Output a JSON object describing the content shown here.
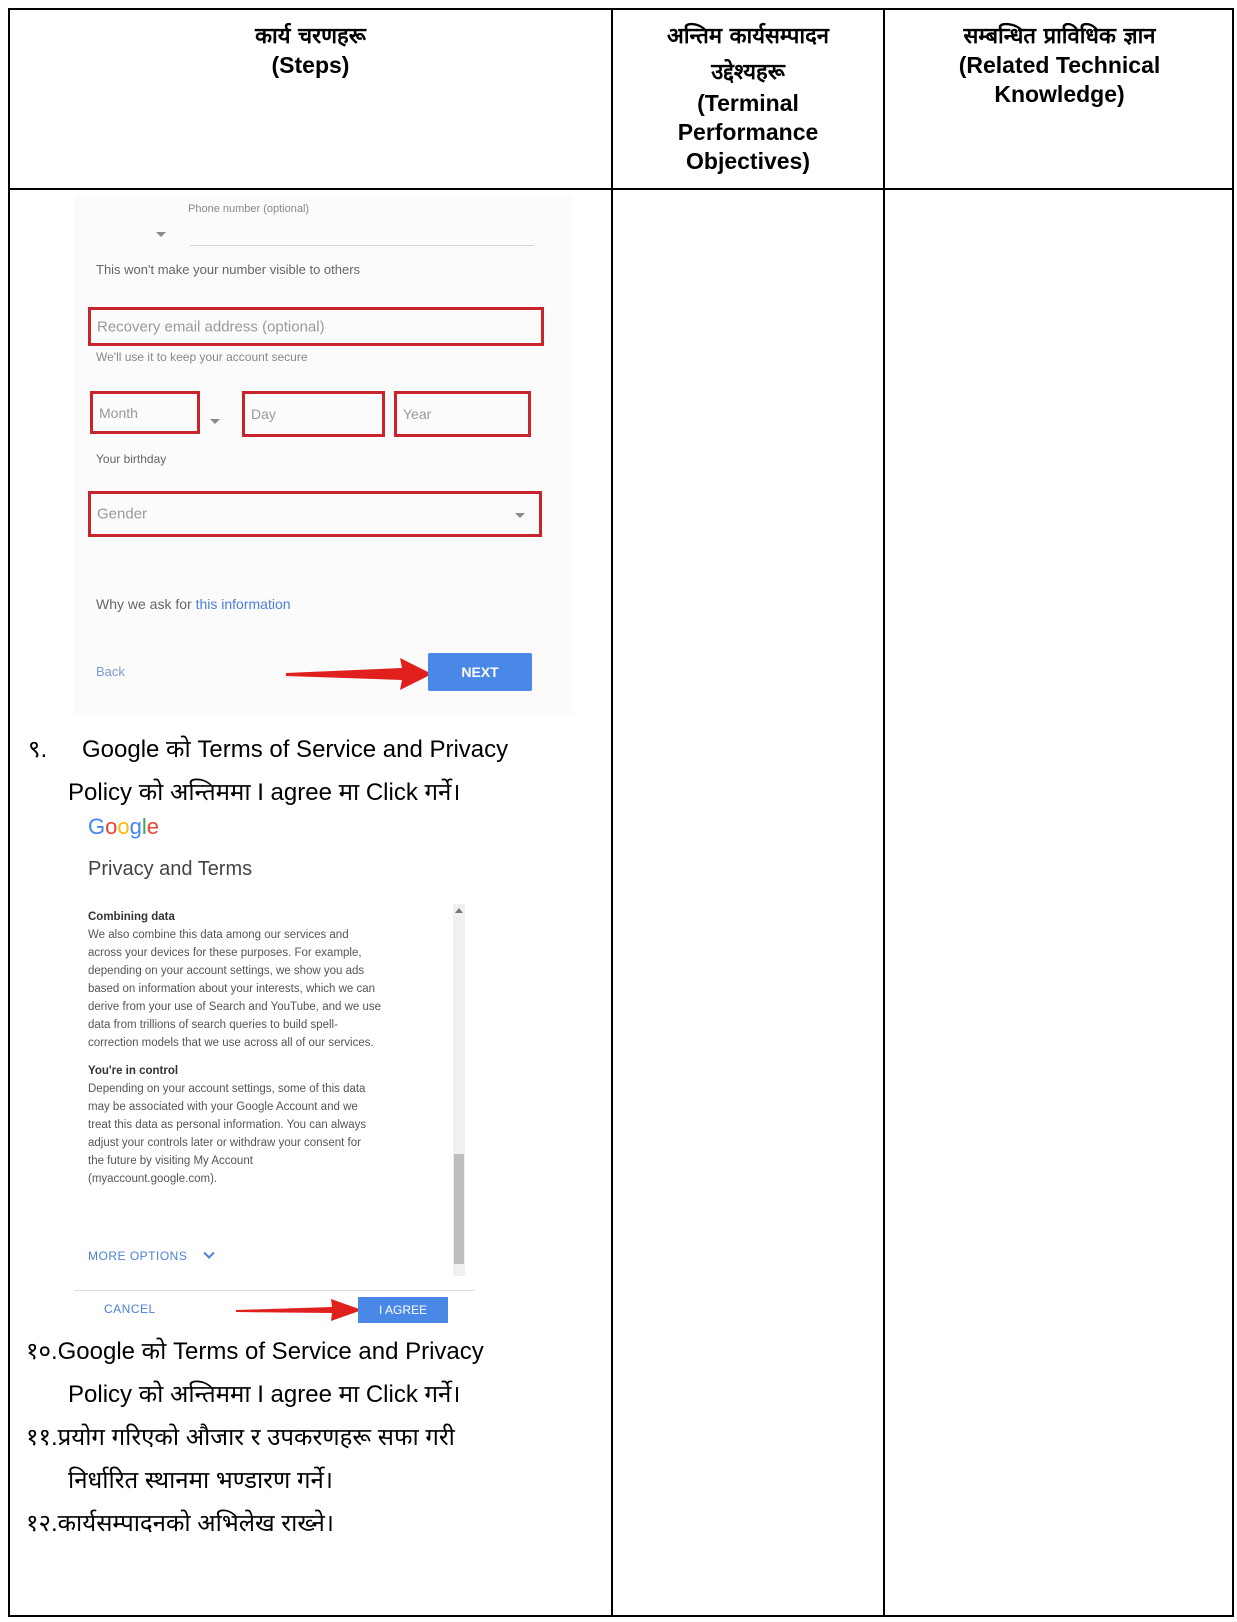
{
  "headers": {
    "steps_np": "कार्य चरणहरू",
    "steps_en": "(Steps)",
    "tpo_np_1": "अन्तिम कार्यसम्पादन",
    "tpo_np_2": "उद्देश्यहरू",
    "tpo_en_1": "(Terminal",
    "tpo_en_2": "Performance",
    "tpo_en_3": "Objectives)",
    "rtk_np": "सम्बन्धित प्राविधिक ज्ञान",
    "rtk_en_1": "(Related Technical",
    "rtk_en_2": "Knowledge)"
  },
  "signup_form": {
    "phone_label": "Phone number (optional)",
    "phone_note": "This won't make your number visible to others",
    "recovery_placeholder": "Recovery email address (optional)",
    "recovery_note": "We'll use it to keep your account secure",
    "month": "Month",
    "day": "Day",
    "year": "Year",
    "birthday_label": "Your birthday",
    "gender": "Gender",
    "why_prefix": "Why we ask for ",
    "why_link": "this information",
    "back": "Back",
    "next": "NEXT"
  },
  "steps": {
    "s9_num": "९.",
    "s9_line1": "Google को Terms of Service and Privacy",
    "s9_line2": "Policy को अन्तिममा I agree मा Click गर्ने।",
    "s10_line1": "१०.Google को Terms of Service and Privacy",
    "s10_line2": "Policy  को अन्तिममा I agree मा Click गर्ने।",
    "s11_line1": "११.प्रयोग गरिएको औजार र उपकरणहरू सफा गरी",
    "s11_line2": "निर्धारित स्थानमा भण्डारण गर्ने।",
    "s12_line1": "१२.कार्यसम्पादनको अभिलेख राख्ने।"
  },
  "privacy": {
    "logo": "Google",
    "title": "Privacy and Terms",
    "h1": "Combining data",
    "p1_lines": [
      "We also combine this data among our services and",
      "across your devices for these purposes. For example,",
      "depending on your account settings, we show you ads",
      "based on information about your interests, which we can",
      "derive from your use of Search and YouTube, and we use",
      "data from trillions of search queries to build spell-",
      "correction models that we use across all of our services."
    ],
    "h2": "You're in control",
    "p2_lines": [
      "Depending on your account settings, some of this data",
      "may be associated with your Google Account and we",
      "treat this data as personal information. You can always",
      "adjust your controls later or withdraw your consent for",
      "the future by visiting My Account",
      "(myaccount.google.com)."
    ],
    "more_options": "MORE OPTIONS",
    "cancel": "CANCEL",
    "agree": "I AGREE"
  },
  "colors": {
    "highlight_red": "#c9232c",
    "button_blue": "#4a88e8",
    "link_blue": "#4c7fd8",
    "arrow_red": "#e0201c"
  }
}
